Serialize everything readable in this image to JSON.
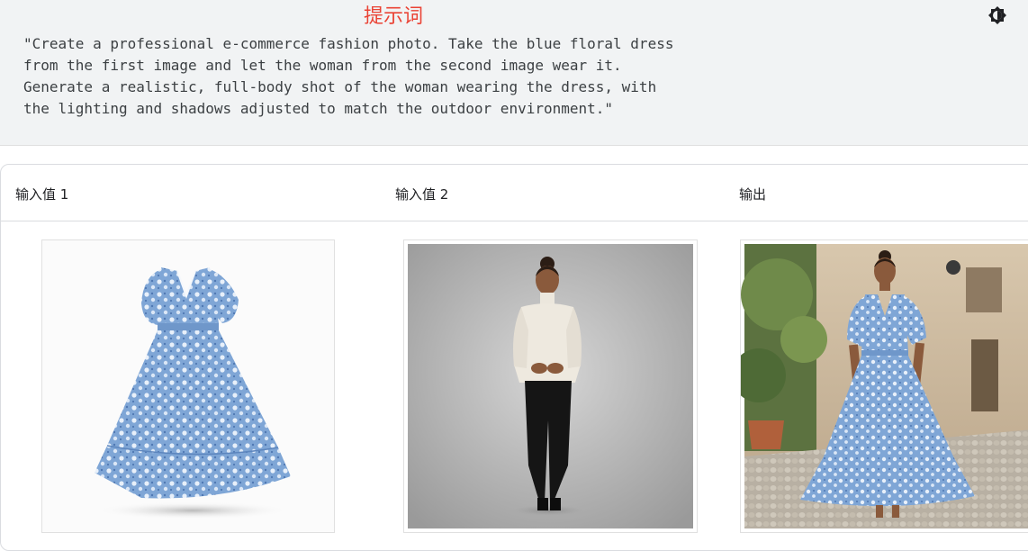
{
  "prompt": {
    "title": "提示词",
    "text": "\"Create a professional e-commerce fashion photo. Take the blue floral dress\nfrom the first image and let the woman from the second image wear it.\nGenerate a realistic, full-body shot of the woman wearing the dress, with\nthe lighting and shadows adjusted to match the outdoor environment.\"",
    "corner_glyph": "「"
  },
  "icons": {
    "theme": "brightness-contrast-icon"
  },
  "table": {
    "headers": [
      "输入值 1",
      "输入值 2",
      "输出"
    ],
    "images": [
      {
        "name": "input-image-blue-floral-dress"
      },
      {
        "name": "input-image-woman-white-sweater"
      },
      {
        "name": "output-image-woman-in-floral-dress"
      }
    ]
  },
  "colors": {
    "prompt_title": "#ea4335",
    "panel_bg": "#f1f3f4",
    "dress_blue": "#7fa6d6"
  }
}
